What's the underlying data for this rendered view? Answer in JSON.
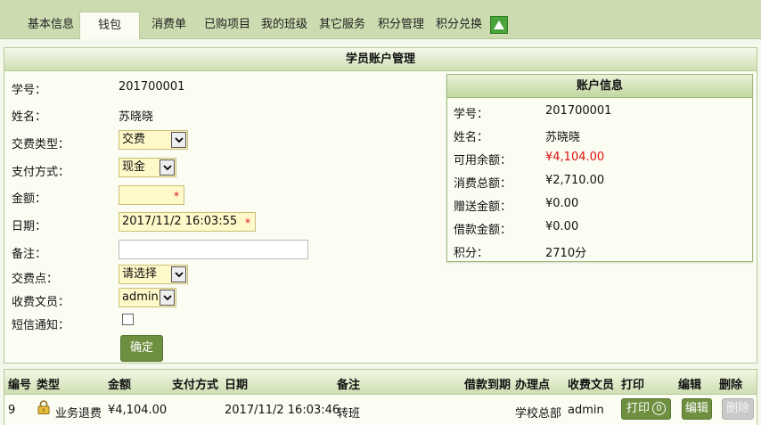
{
  "tabs": [
    {
      "label": "基本信息",
      "active": false
    },
    {
      "label": "钱包",
      "active": true
    },
    {
      "label": "消费单",
      "active": false
    },
    {
      "label": "已购项目",
      "active": false
    },
    {
      "label": "我的班级",
      "active": false
    },
    {
      "label": "其它服务",
      "active": false
    },
    {
      "label": "积分管理",
      "active": false
    },
    {
      "label": "积分兑换",
      "active": false
    }
  ],
  "collapse_icon": "triangle-up-icon",
  "form": {
    "title": "学员账户管理",
    "student_no_label": "学号：",
    "student_no": "201700001",
    "name_label": "姓名：",
    "name": "苏晓晓",
    "pay_type_label": "交费类型：",
    "pay_type": "交费",
    "pay_method_label": "支付方式：",
    "pay_method": "现金",
    "amount_label": "金额：",
    "amount": "",
    "date_label": "日期：",
    "date": "2017/11/2 16:03:55",
    "remark_label": "备注：",
    "remark": "",
    "pay_point_label": "交费点：",
    "pay_point": "请选择",
    "clerk_label": "收费文员：",
    "clerk": "admin",
    "sms_label": "短信通知：",
    "sms_checked": false,
    "required_mark": "*",
    "submit_label": "确定"
  },
  "account": {
    "title": "账户信息",
    "rows": [
      {
        "label": "学号：",
        "value": "201700001",
        "highlight": false
      },
      {
        "label": "姓名：",
        "value": "苏晓晓",
        "highlight": false
      },
      {
        "label": "可用余额：",
        "value": "¥4,104.00",
        "highlight": true
      },
      {
        "label": "消费总额：",
        "value": "¥2,710.00",
        "highlight": false
      },
      {
        "label": "赠送金额：",
        "value": "¥0.00",
        "highlight": false
      },
      {
        "label": "借款金额：",
        "value": "¥0.00",
        "highlight": false
      },
      {
        "label": "积分：",
        "value": "2710分",
        "highlight": false
      }
    ],
    "highlight_color": "#e01010"
  },
  "table": {
    "headers": [
      "编号",
      "类型",
      "金额",
      "支付方式",
      "日期",
      "备注",
      "借款到期",
      "办理点",
      "收费文员",
      "打印",
      "编辑",
      "删除"
    ],
    "rows": [
      {
        "no": "9",
        "type_icon": "lock-icon",
        "type": "业务退费",
        "amount": "¥4,104.00",
        "pay_method": "",
        "date": "2017/11/2 16:03:46",
        "remark": "转班",
        "loan_due": "",
        "branch": "学校总部",
        "clerk": "admin",
        "print_label": "打印",
        "print_count": "0",
        "edit_label": "编辑",
        "delete_label": "删除"
      }
    ]
  },
  "colors": {
    "tab_bar": "#ccdcb0",
    "panel_bg": "#fbfdf3",
    "button_green": "#6e8f40",
    "input_yellow": "#fff8c8",
    "required_red": "#e01010"
  }
}
